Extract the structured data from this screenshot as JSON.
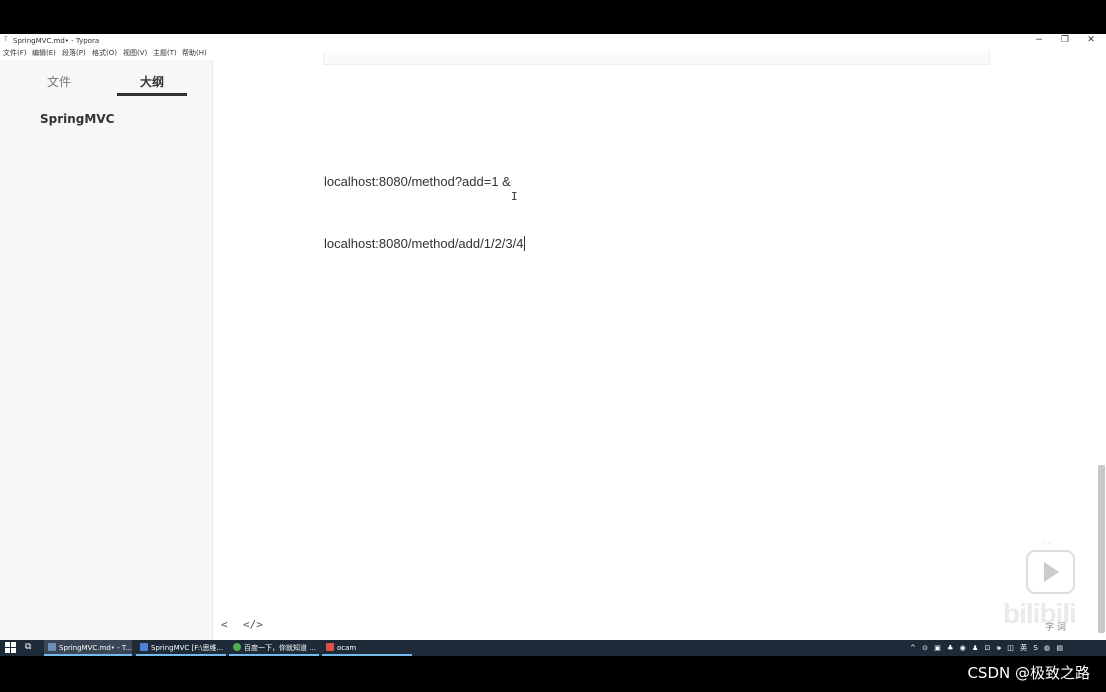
{
  "window": {
    "title": "SpringMVC.md• - Typora",
    "controls": {
      "minimize": "−",
      "restore": "❐",
      "close": "✕"
    }
  },
  "menu": [
    "文件(F)",
    "编辑(E)",
    "段落(P)",
    "格式(O)",
    "视图(V)",
    "主题(T)",
    "帮助(H)"
  ],
  "sidebar": {
    "tabs": [
      {
        "label": "文件",
        "active": false
      },
      {
        "label": "大纲",
        "active": true
      }
    ],
    "outline": [
      "SpringMVC"
    ]
  },
  "editor": {
    "paragraphs": [
      "localhost:8080/method?add=1 &",
      "localhost:8080/method/add/1/2/3/4"
    ]
  },
  "footer": {
    "back": "<",
    "source_toggle": "</>"
  },
  "overlay": {
    "watermark": "bilibili",
    "word_count": "字 词"
  },
  "taskbar": {
    "items": [
      {
        "label": "SpringMVC.md• - T...",
        "icon_color": "#6d8fb5",
        "active": true
      },
      {
        "label": "SpringMVC [F:\\思维...",
        "icon_color": "#4f7fd8",
        "active": false
      },
      {
        "label": "百度一下，你就知道 ...",
        "icon_color": "#4caf50",
        "active": false
      },
      {
        "label": "ocam",
        "icon_color": "#e0504a",
        "active": false
      }
    ],
    "tray": [
      "^",
      "⊙",
      "▣",
      "♣",
      "◉",
      "♟",
      "⊡",
      "🕪",
      "◫",
      "英",
      "S",
      "◍",
      "▤"
    ]
  },
  "credit": "CSDN @极致之路"
}
